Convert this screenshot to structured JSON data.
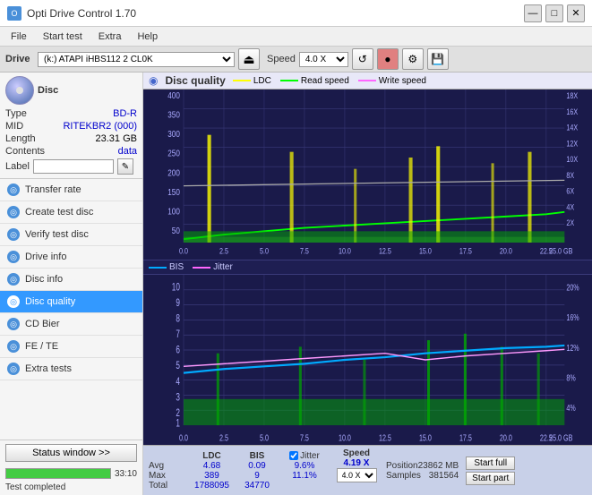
{
  "app": {
    "title": "Opti Drive Control 1.70",
    "icon": "O"
  },
  "titlebar": {
    "controls": [
      "—",
      "□",
      "✕"
    ]
  },
  "menubar": {
    "items": [
      "File",
      "Start test",
      "Extra",
      "Help"
    ]
  },
  "drive_toolbar": {
    "drive_label": "Drive",
    "drive_value": "(k:) ATAPI iHBS112  2 CL0K",
    "eject_icon": "⏏",
    "speed_label": "Speed",
    "speed_value": "4.0 X",
    "btn_icons": [
      "↺",
      "🔴",
      "💾"
    ]
  },
  "disc": {
    "title": "Disc",
    "type_label": "Type",
    "type_value": "BD-R",
    "mid_label": "MID",
    "mid_value": "RITEKBR2 (000)",
    "length_label": "Length",
    "length_value": "23.31 GB",
    "contents_label": "Contents",
    "contents_value": "data",
    "label_label": "Label",
    "label_value": ""
  },
  "nav": {
    "items": [
      {
        "id": "transfer-rate",
        "label": "Transfer rate",
        "icon": "◎"
      },
      {
        "id": "create-test-disc",
        "label": "Create test disc",
        "icon": "◎"
      },
      {
        "id": "verify-test-disc",
        "label": "Verify test disc",
        "icon": "◎"
      },
      {
        "id": "drive-info",
        "label": "Drive info",
        "icon": "◎"
      },
      {
        "id": "disc-info",
        "label": "Disc info",
        "icon": "◎"
      },
      {
        "id": "disc-quality",
        "label": "Disc quality",
        "icon": "◎",
        "active": true
      },
      {
        "id": "cd-bier",
        "label": "CD Bier",
        "icon": "◎"
      },
      {
        "id": "fe-te",
        "label": "FE / TE",
        "icon": "◎"
      },
      {
        "id": "extra-tests",
        "label": "Extra tests",
        "icon": "◎"
      }
    ]
  },
  "status_window_btn": "Status window >>",
  "progress": {
    "value": 100,
    "display": "100.0%",
    "time": "33:10"
  },
  "status_text": "Test completed",
  "chart": {
    "title": "Disc quality",
    "icon": "◉",
    "legend": [
      {
        "label": "LDC",
        "color": "#ffff00"
      },
      {
        "label": "Read speed",
        "color": "#00ff00"
      },
      {
        "label": "Write speed",
        "color": "#ff66ff"
      }
    ],
    "top": {
      "y_max": 400,
      "y_labels_left": [
        "400",
        "350",
        "300",
        "250",
        "200",
        "150",
        "100",
        "50"
      ],
      "y_labels_right": [
        "18X",
        "16X",
        "14X",
        "12X",
        "10X",
        "8X",
        "6X",
        "4X",
        "2X"
      ],
      "x_labels": [
        "0.0",
        "2.5",
        "5.0",
        "7.5",
        "10.0",
        "12.5",
        "15.0",
        "17.5",
        "20.0",
        "22.5",
        "25.0 GB"
      ]
    },
    "bottom": {
      "legend": [
        {
          "label": "BIS",
          "color": "#00aaff"
        },
        {
          "label": "Jitter",
          "color": "#ff66ff"
        }
      ],
      "y_labels_left": [
        "10",
        "9",
        "8",
        "7",
        "6",
        "5",
        "4",
        "3",
        "2",
        "1"
      ],
      "y_labels_right": [
        "20%",
        "16%",
        "12%",
        "8%",
        "4%"
      ],
      "x_labels": [
        "0.0",
        "2.5",
        "5.0",
        "7.5",
        "10.0",
        "12.5",
        "15.0",
        "17.5",
        "20.0",
        "22.5",
        "25.0 GB"
      ]
    }
  },
  "stats": {
    "columns": [
      "LDC",
      "BIS",
      "",
      "Jitter",
      "Speed",
      ""
    ],
    "avg_label": "Avg",
    "avg_ldc": "4.68",
    "avg_bis": "0.09",
    "avg_jitter": "9.6%",
    "avg_speed": "4.19 X",
    "speed_select": "4.0 X",
    "max_label": "Max",
    "max_ldc": "389",
    "max_bis": "9",
    "max_jitter": "11.1%",
    "position_label": "Position",
    "position_value": "23862 MB",
    "total_label": "Total",
    "total_ldc": "1788095",
    "total_bis": "34770",
    "samples_label": "Samples",
    "samples_value": "381564",
    "jitter_checked": true,
    "start_full_label": "Start full",
    "start_part_label": "Start part"
  }
}
